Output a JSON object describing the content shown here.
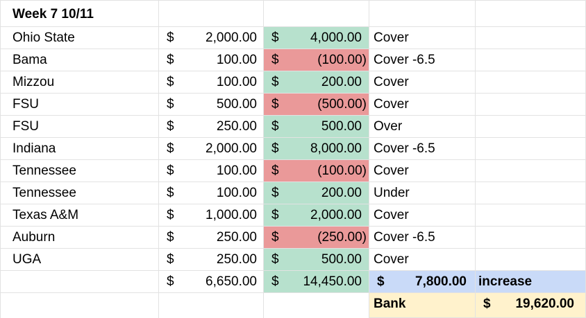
{
  "title": "Week 7 10/11",
  "currency_symbol": "$",
  "rows": [
    {
      "team": "Ohio State",
      "wager": "2,000.00",
      "result": "4,000.00",
      "status": "win",
      "bet": "Cover"
    },
    {
      "team": "Bama",
      "wager": "100.00",
      "result": "(100.00)",
      "status": "loss",
      "bet": "Cover -6.5"
    },
    {
      "team": "Mizzou",
      "wager": "100.00",
      "result": "200.00",
      "status": "win",
      "bet": "Cover"
    },
    {
      "team": "FSU",
      "wager": "500.00",
      "result": "(500.00)",
      "status": "loss",
      "bet": "Cover"
    },
    {
      "team": "FSU",
      "wager": "250.00",
      "result": "500.00",
      "status": "win",
      "bet": "Over"
    },
    {
      "team": "Indiana",
      "wager": "2,000.00",
      "result": "8,000.00",
      "status": "win",
      "bet": "Cover -6.5"
    },
    {
      "team": "Tennessee",
      "wager": "100.00",
      "result": "(100.00)",
      "status": "loss",
      "bet": "Cover"
    },
    {
      "team": "Tennessee",
      "wager": "100.00",
      "result": "200.00",
      "status": "win",
      "bet": "Under"
    },
    {
      "team": "Texas A&M",
      "wager": "1,000.00",
      "result": "2,000.00",
      "status": "win",
      "bet": "Cover"
    },
    {
      "team": "Auburn",
      "wager": "250.00",
      "result": "(250.00)",
      "status": "loss",
      "bet": "Cover -6.5"
    },
    {
      "team": "UGA",
      "wager": "250.00",
      "result": "500.00",
      "status": "win",
      "bet": "Cover"
    }
  ],
  "totals": {
    "wager_total": "6,650.00",
    "result_total": "14,450.00",
    "net": "7,800.00",
    "net_label": "increase"
  },
  "bank": {
    "label": "Bank",
    "value": "19,620.00"
  },
  "colors": {
    "win": "#b7e1cd",
    "loss": "#ea9999",
    "net_highlight": "#c9daf8",
    "bank_highlight": "#fff2cc"
  }
}
